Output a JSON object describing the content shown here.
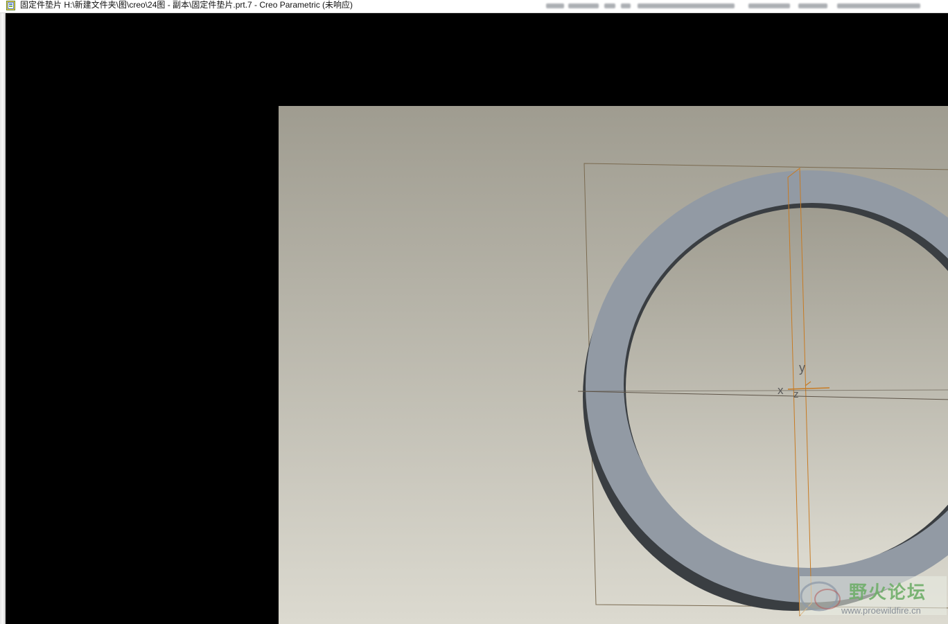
{
  "window": {
    "title": "固定件垫片 H:\\新建文件夹\\图\\creo\\24图 - 副本\\固定件垫片.prt.7 - Creo Parametric (未响应)"
  },
  "model": {
    "canvas_bg_top": "#9f9c90",
    "canvas_bg_bottom": "#dcdad0",
    "washer_face": "#929aa4",
    "washer_shadow": "#3a3e42",
    "plane_color": "#7a6a50",
    "axis_color": "#c77a22",
    "axis_labels": {
      "x": "x",
      "y": "y",
      "z": "z"
    }
  },
  "watermark": {
    "name": "野火论坛",
    "url": "www.proewildfire.cn"
  }
}
